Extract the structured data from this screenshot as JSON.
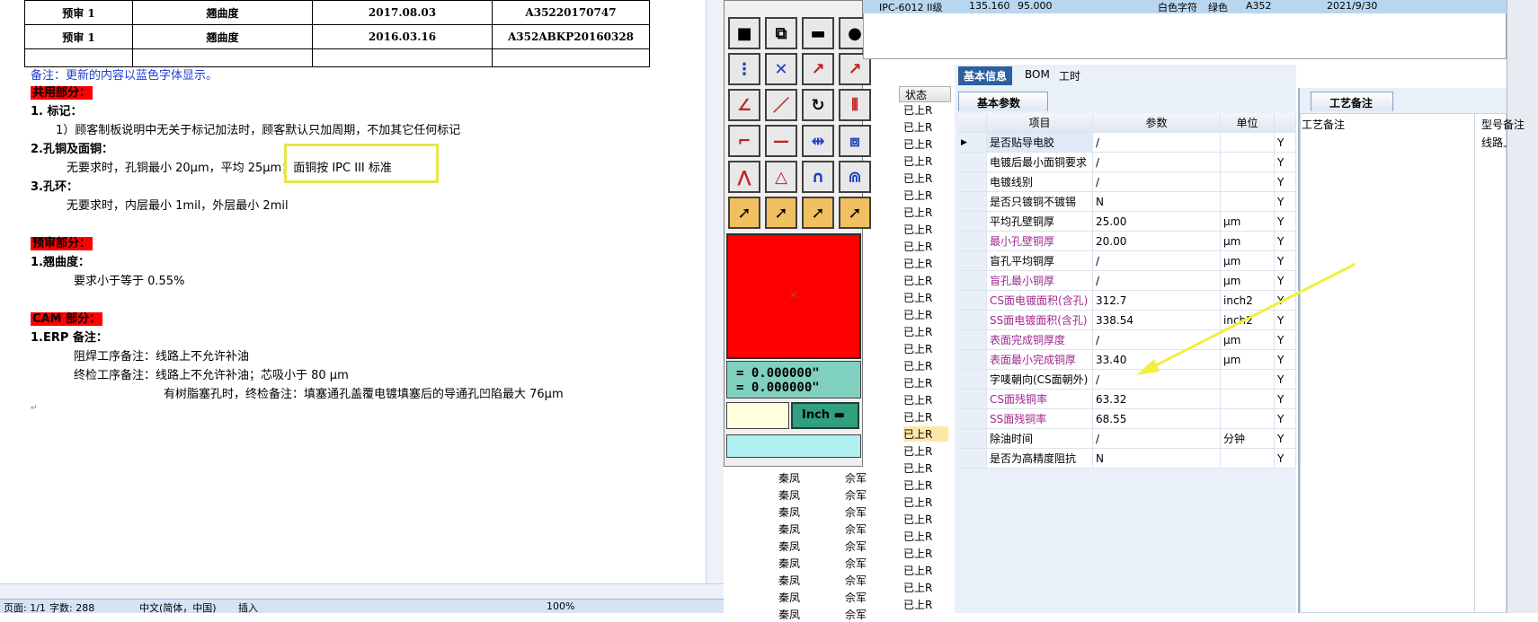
{
  "doc": {
    "table_rows": [
      {
        "c1": "预审 1",
        "c2": "翘曲度",
        "c3": "2017.08.03",
        "c4": "A35220170747"
      },
      {
        "c1": "预审 1",
        "c2": "翘曲度",
        "c3": "2016.03.16",
        "c4": "A352ABKP20160328"
      }
    ],
    "note": "备注：更新的内容以蓝色字体显示。",
    "sec_common": "共用部分：",
    "item1": "1.   标记：",
    "item1_text": "1）顾客制板说明中无关于标记加法时，顾客默认只加周期，不加其它任何标记",
    "item2": "2.孔铜及面铜：",
    "item2_text_a": "无要求时，孔铜最小 20μm，平均 25μm；",
    "item2_text_b": "面铜按 IPC III 标准",
    "item3": "3.孔环：",
    "item3_text": "无要求时，内层最小 1mil，外层最小 2mil",
    "sec_pre": "预审部分：",
    "pre1": "1.翘曲度：",
    "pre1_text": "要求小于等于 0.55%",
    "sec_cam": "CAM 部分：",
    "cam1": "1.ERP 备注：",
    "cam1_a": "阻焊工序备注：线路上不允许补油",
    "cam1_b": "终检工序备注：线路上不允许补油；芯吸小于 80 μm",
    "cam1_c": "有树脂塞孔时，终检备注：填塞通孔盖覆电镀填塞后的导通孔凹陷最大 76μm",
    "para_mark": "↵"
  },
  "status": {
    "page": "页面: 1/1",
    "words": "字数: 288",
    "lang": "中文(简体，中国)",
    "mode": "插入",
    "zoom": "100%"
  },
  "grid": {
    "state_header": "状态",
    "state_value": "已上R",
    "name_a": "秦凤",
    "name_b": "佘军"
  },
  "palette": {
    "coord_x": "= 0.000000\"",
    "coord_y": "= 0.000000\"",
    "unit": "Inch"
  },
  "top_row": {
    "a": "IPC-6012 II级",
    "b": "135.160",
    "c": "95.000",
    "d": "白色字符",
    "e": "绿色",
    "f": "A352",
    "g": "2021/9/30"
  },
  "details": {
    "tabs": [
      "基本信息",
      "BOM",
      "工时"
    ],
    "sub_tab": "基本参数",
    "headers": [
      "项目",
      "参数",
      "单位"
    ],
    "rows": [
      {
        "item": "是否贴导电胶",
        "val": "/",
        "unit": "",
        "flag": "Y",
        "mag": false
      },
      {
        "item": "电镀后最小面铜要求",
        "val": "/",
        "unit": "",
        "flag": "Y",
        "mag": false
      },
      {
        "item": "电镀线别",
        "val": "/",
        "unit": "",
        "flag": "Y",
        "mag": false
      },
      {
        "item": "是否只镀铜不镀锡",
        "val": "N",
        "unit": "",
        "flag": "Y",
        "mag": false
      },
      {
        "item": "平均孔壁铜厚",
        "val": "25.00",
        "unit": "μm",
        "flag": "Y",
        "mag": false
      },
      {
        "item": "最小孔壁铜厚",
        "val": "20.00",
        "unit": "μm",
        "flag": "Y",
        "mag": true
      },
      {
        "item": "盲孔平均铜厚",
        "val": "/",
        "unit": "μm",
        "flag": "Y",
        "mag": false
      },
      {
        "item": "盲孔最小铜厚",
        "val": "/",
        "unit": "μm",
        "flag": "Y",
        "mag": true
      },
      {
        "item": "CS面电镀面积(含孔)",
        "val": "312.7",
        "unit": "inch2",
        "flag": "Y",
        "mag": true
      },
      {
        "item": "SS面电镀面积(含孔)",
        "val": "338.54",
        "unit": "inch2",
        "flag": "Y",
        "mag": true
      },
      {
        "item": "表面完成铜厚度",
        "val": "/",
        "unit": "μm",
        "flag": "Y",
        "mag": true
      },
      {
        "item": "表面最小完成铜厚",
        "val": "33.40",
        "unit": "μm",
        "flag": "Y",
        "mag": true
      },
      {
        "item": "字唛朝向(CS面朝外)",
        "val": "/",
        "unit": "",
        "flag": "Y",
        "mag": false
      },
      {
        "item": "CS面残铜率",
        "val": "63.32",
        "unit": "",
        "flag": "Y",
        "mag": true
      },
      {
        "item": "SS面残铜率",
        "val": "68.55",
        "unit": "",
        "flag": "Y",
        "mag": true
      },
      {
        "item": "除油时间",
        "val": "/",
        "unit": "分钟",
        "flag": "Y",
        "mag": false
      },
      {
        "item": "是否为高精度阻抗",
        "val": "N",
        "unit": "",
        "flag": "Y",
        "mag": false
      }
    ]
  },
  "craft": {
    "tab": "工艺备注",
    "col1": "工艺备注",
    "col2": "型号备注",
    "value": "线路上不允许补油"
  },
  "colors": {
    "section_bg": "#ff0000",
    "note_blue": "#1f3cd6",
    "highlight_box": "#e6e64a",
    "arrow": "#f0f040",
    "tab_active": "#2a5fa0"
  }
}
